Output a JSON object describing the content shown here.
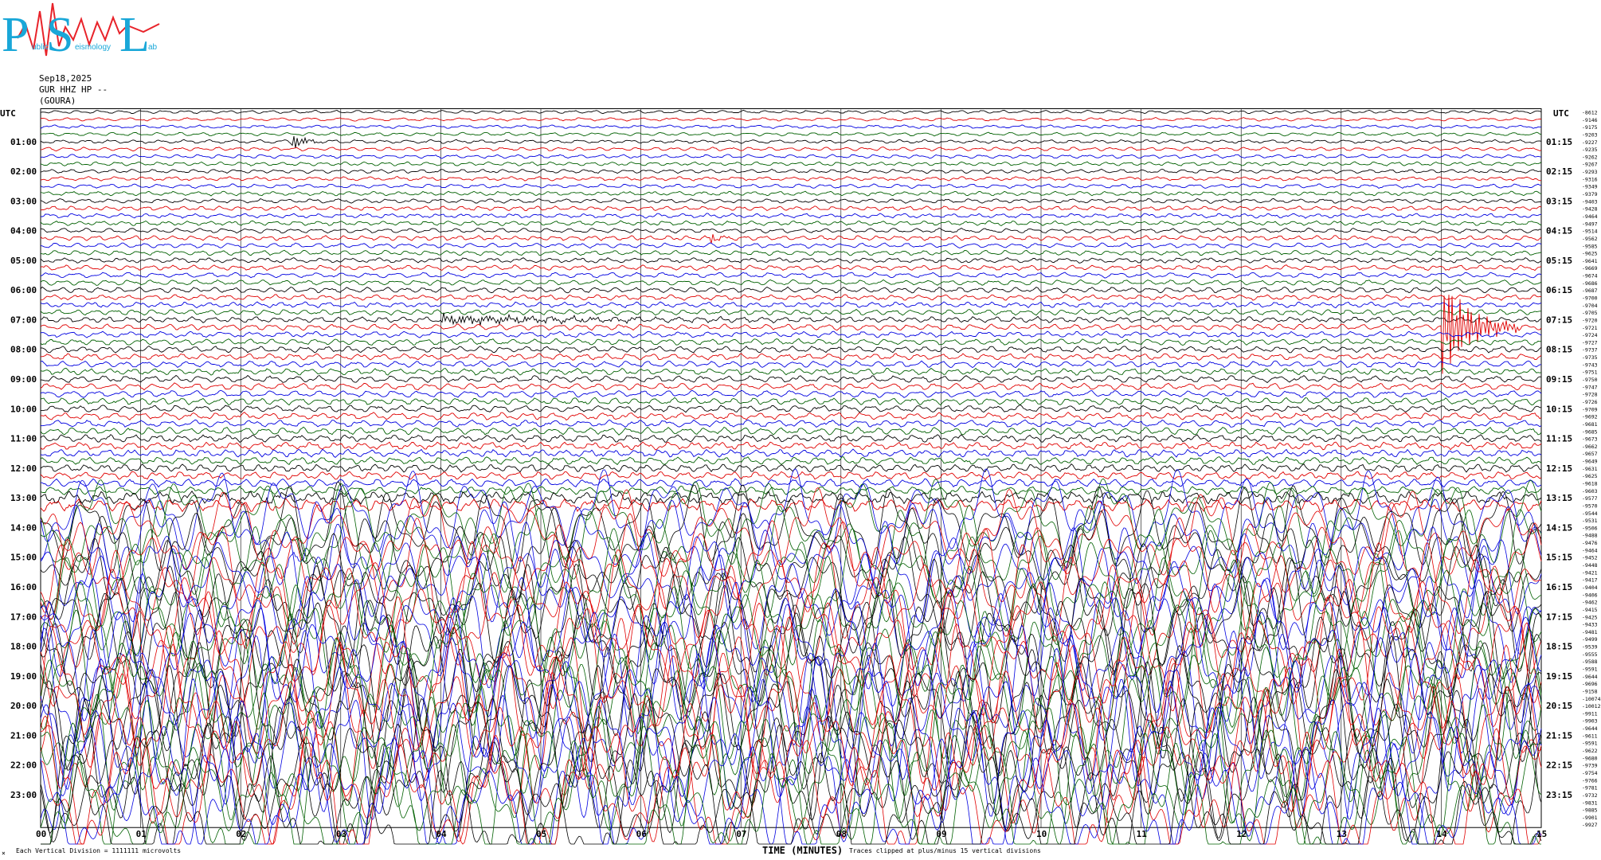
{
  "logo": {
    "big_letters": [
      "P",
      "S",
      "L"
    ],
    "small_text": [
      "ublic",
      "eismology",
      "ab"
    ],
    "colors": {
      "letters": "#19a7d8",
      "wave": "#e8232a"
    }
  },
  "header": {
    "date": "Sep18,2025",
    "channel": "GUR HHZ HP --",
    "station": "(GOURA)"
  },
  "left_axis_title": "UTC",
  "right_axis_title": "UTC",
  "footer": {
    "left_mark": "×",
    "division_note": "Each Vertical Division = 1111111 microvolts",
    "axis_title": "TIME (MINUTES)",
    "clip_note": "Traces clipped at plus/minus 15 vertical divisions"
  },
  "colors": {
    "trace_cycle": [
      "#000000",
      "#e00000",
      "#0000e0",
      "#006000"
    ],
    "grid": "#000000"
  },
  "chart_data": {
    "type": "line",
    "title": "GUR HHZ HP --",
    "xlabel": "TIME (MINUTES)",
    "ylabel": "UTC",
    "x_ticks": [
      "00",
      "01",
      "02",
      "03",
      "04",
      "05",
      "06",
      "07",
      "08",
      "09",
      "10",
      "11",
      "12",
      "13",
      "14",
      "15"
    ],
    "xlim": [
      0,
      15
    ],
    "rows_per_hour": 4,
    "minutes_per_row": 15,
    "left_hour_labels": [
      "01:00",
      "02:00",
      "03:00",
      "04:00",
      "05:00",
      "06:00",
      "07:00",
      "08:00",
      "09:00",
      "10:00",
      "11:00",
      "12:00",
      "13:00",
      "14:00",
      "15:00",
      "16:00",
      "17:00",
      "18:00",
      "19:00",
      "20:00",
      "21:00",
      "22:00",
      "23:00"
    ],
    "right_hour_labels": [
      "01:15",
      "02:15",
      "03:15",
      "04:15",
      "05:15",
      "06:15",
      "07:15",
      "08:15",
      "09:15",
      "10:15",
      "11:15",
      "12:15",
      "13:15",
      "14:15",
      "15:15",
      "16:15",
      "17:15",
      "18:15",
      "19:15",
      "20:15",
      "21:15",
      "22:15",
      "23:15"
    ],
    "row_offsets": [
      "-8612",
      "-9146",
      "-9175",
      "-9203",
      "-9227",
      "-9235",
      "-9262",
      "-9267",
      "-9293",
      "-9316",
      "-9349",
      "-9379",
      "-9403",
      "-9428",
      "-9464",
      "-9497",
      "-9514",
      "-9562",
      "-9585",
      "-9625",
      "-9641",
      "-9669",
      "-9674",
      "-9686",
      "-9687",
      "-9700",
      "-9704",
      "-9705",
      "-9720",
      "-9721",
      "-9724",
      "-9727",
      "-9737",
      "-9735",
      "-9743",
      "-9751",
      "-9750",
      "-9747",
      "-9728",
      "-9726",
      "-9709",
      "-9692",
      "-9681",
      "-9685",
      "-9673",
      "-9662",
      "-9657",
      "-9649",
      "-9631",
      "-9625",
      "-9618",
      "-9603",
      "-9577",
      "-9570",
      "-9544",
      "-9531",
      "-9506",
      "-9488",
      "-9476",
      "-9464",
      "-9452",
      "-9448",
      "-9421",
      "-9417",
      "-9404",
      "-9406",
      "-9462",
      "-9415",
      "-9425",
      "-9433",
      "-9481",
      "-9499",
      "-9539",
      "-9555",
      "-9588",
      "-9591",
      "-9644",
      "-9696",
      "-9158",
      "-10074",
      "-10012",
      "-9911",
      "-9903",
      "-9644",
      "-9611",
      "-9591",
      "-9622",
      "-9680",
      "-9739",
      "-9754",
      "-9766",
      "-9781",
      "-9732",
      "-9831",
      "-9885",
      "-9901",
      "-9927"
    ],
    "series": [
      {
        "name": "black",
        "color": "#000000"
      },
      {
        "name": "red",
        "color": "#e00000"
      },
      {
        "name": "blue",
        "color": "#0000e0"
      },
      {
        "name": "green",
        "color": "#006000"
      }
    ],
    "events": [
      {
        "row": 4,
        "minute": 2.5,
        "amplitude": 2.4,
        "duration_min": 0.35,
        "color": "#e00000"
      },
      {
        "row": 17,
        "minute": 6.7,
        "amplitude": 1.5,
        "duration_min": 0.2,
        "color": "#0000e0"
      },
      {
        "row": 28,
        "minute": 4.0,
        "amplitude": 1.2,
        "duration_min": 3.2,
        "color": "#000000"
      },
      {
        "row": 29,
        "minute": 14.0,
        "amplitude": 14,
        "duration_min": 0.8,
        "color": "#e00000"
      },
      {
        "row": 52,
        "minute": 2.2,
        "amplitude": 1.0,
        "duration_min": 0.4,
        "color": "#000000"
      },
      {
        "row": 58,
        "minute": 2.4,
        "amplitude": 0.8,
        "duration_min": 0.6,
        "color": "#e00000"
      }
    ],
    "noise": {
      "quiet_until_row": 52,
      "high_from_row": 54,
      "quiet_amplitude": 0.45,
      "mid_amplitude": 1.1,
      "high_amplitude": 10
    },
    "grid": true
  }
}
